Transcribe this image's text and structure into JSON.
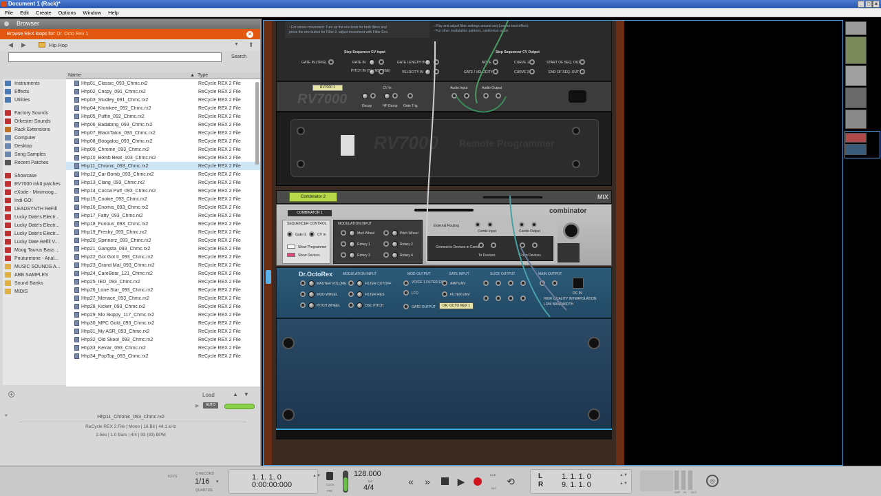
{
  "window": {
    "title": "Document 1 (Rack)*"
  },
  "menu": [
    "File",
    "Edit",
    "Create",
    "Options",
    "Window",
    "Help"
  ],
  "browser": {
    "title": "Browser",
    "banner_prefix": "Browse REX loops for:",
    "banner_target": "Dr. Octo Rex 1",
    "path": "Hip Hop",
    "search_placeholder": "",
    "search_label": "Search",
    "col_name": "Name",
    "col_type": "Type",
    "locations": [
      {
        "label": "Instruments",
        "color": "#4a7ab8"
      },
      {
        "label": "Effects",
        "color": "#4a7ab8"
      },
      {
        "label": "Utilities",
        "color": "#4a7ab8"
      },
      {
        "label": "",
        "color": ""
      },
      {
        "label": "Factory Sounds",
        "color": "#c03030"
      },
      {
        "label": "Orkester Sounds",
        "color": "#c03030"
      },
      {
        "label": "Rack Extensions",
        "color": "#c07020"
      },
      {
        "label": "Computer",
        "color": "#6a88b0"
      },
      {
        "label": "Desktop",
        "color": "#6a88b0"
      },
      {
        "label": "Song Samples",
        "color": "#6a88b0"
      },
      {
        "label": "Recent Patches",
        "color": "#555555"
      },
      {
        "label": "",
        "color": ""
      },
      {
        "label": "Showcase",
        "color": "#c03030"
      },
      {
        "label": "RV7000 mkII patches",
        "color": "#c03030"
      },
      {
        "label": "eXode - Minimoog...",
        "color": "#c03030"
      },
      {
        "label": "Indi-GO!",
        "color": "#c03030"
      },
      {
        "label": "LEADSYNTH ReFill",
        "color": "#c03030"
      },
      {
        "label": "Lucky Date's Electr...",
        "color": "#c03030"
      },
      {
        "label": "Lucky Date's Electr...",
        "color": "#c03030"
      },
      {
        "label": "Lucky Date's Electr...",
        "color": "#c03030"
      },
      {
        "label": "Lucky Date Refill V...",
        "color": "#c03030"
      },
      {
        "label": "Moog Taurus Bass ...",
        "color": "#c03030"
      },
      {
        "label": "Pnuturetone - Anal...",
        "color": "#c03030"
      },
      {
        "label": "MUSIC SOUNDS A...",
        "color": "#e0b040"
      },
      {
        "label": "ABB SAMPLES",
        "color": "#e0b040"
      },
      {
        "label": "Sound Banks",
        "color": "#e0b040"
      },
      {
        "label": "MIDIS",
        "color": "#e0b040"
      }
    ],
    "files": [
      {
        "name": "Hhp01_Classic_093_Chmc.rx2",
        "type": "ReCycle REX 2 File"
      },
      {
        "name": "Hhp02_Crispy_091_Chmc.rx2",
        "type": "ReCycle REX 2 File"
      },
      {
        "name": "Hhp03_Studley_091_Chmc.rx2",
        "type": "ReCycle REX 2 File"
      },
      {
        "name": "Hhp04_Kronikee_092_Chmc.rx2",
        "type": "ReCycle REX 2 File"
      },
      {
        "name": "Hhp05_Puffin_092_Chmc.rx2",
        "type": "ReCycle REX 2 File"
      },
      {
        "name": "Hhp06_Badabing_093_Chmc.rx2",
        "type": "ReCycle REX 2 File"
      },
      {
        "name": "Hhp07_BlackTalon_093_Chmc.rx2",
        "type": "ReCycle REX 2 File"
      },
      {
        "name": "Hhp08_Boogaloo_093_Chmc.rx2",
        "type": "ReCycle REX 2 File"
      },
      {
        "name": "Hhp09_Chrome_093_Chmc.rx2",
        "type": "ReCycle REX 2 File"
      },
      {
        "name": "Hhp10_Bomb Beat_103_Chmc.rx2",
        "type": "ReCycle REX 2 File"
      },
      {
        "name": "Hhp11_Chronic_093_Chmc.rx2",
        "type": "ReCycle REX 2 File"
      },
      {
        "name": "Hhp12_Car Bomb_093_Chmc.rx2",
        "type": "ReCycle REX 2 File"
      },
      {
        "name": "Hhp13_Clang_093_Chmc.rx2",
        "type": "ReCycle REX 2 File"
      },
      {
        "name": "Hhp14_Cocoa Puff_093_Chmc.rx2",
        "type": "ReCycle REX 2 File"
      },
      {
        "name": "Hhp15_Cookie_093_Chmc.rx2",
        "type": "ReCycle REX 2 File"
      },
      {
        "name": "Hhp16_Enomis_093_Chmc.rx2",
        "type": "ReCycle REX 2 File"
      },
      {
        "name": "Hhp17_Fatty_093_Chmc.rx2",
        "type": "ReCycle REX 2 File"
      },
      {
        "name": "Hhp18_Furious_093_Chmc.rx2",
        "type": "ReCycle REX 2 File"
      },
      {
        "name": "Hhp19_Freshy_093_Chmc.rx2",
        "type": "ReCycle REX 2 File"
      },
      {
        "name": "Hhp20_Spinnerz_093_Chmc.rx2",
        "type": "ReCycle REX 2 File"
      },
      {
        "name": "Hhp21_Gangsta_093_Chmc.rx2",
        "type": "ReCycle REX 2 File"
      },
      {
        "name": "Hhp22_Got Got It_093_Chmc.rx2",
        "type": "ReCycle REX 2 File"
      },
      {
        "name": "Hhp23_Grand Mal_093_Chmc.rx2",
        "type": "ReCycle REX 2 File"
      },
      {
        "name": "Hhp24_CareBear_121_Chmc.rx2",
        "type": "ReCycle REX 2 File"
      },
      {
        "name": "Hhp25_IED_093_Chmc.rx2",
        "type": "ReCycle REX 2 File"
      },
      {
        "name": "Hhp26_Lone Star_093_Chmc.rx2",
        "type": "ReCycle REX 2 File"
      },
      {
        "name": "Hhp27_Menace_093_Chmc.rx2",
        "type": "ReCycle REX 2 File"
      },
      {
        "name": "Hhp28_Kicker_093_Chmc.rx2",
        "type": "ReCycle REX 2 File"
      },
      {
        "name": "Hhp29_Mo Skippy_117_Chmc.rx2",
        "type": "ReCycle REX 2 File"
      },
      {
        "name": "Hhp30_MPC Gold_093_Chmc.rx2",
        "type": "ReCycle REX 2 File"
      },
      {
        "name": "Hhp31_My ASR_093_Chmc.rx2",
        "type": "ReCycle REX 2 File"
      },
      {
        "name": "Hhp32_Old Skool_093_Chmc.rx2",
        "type": "ReCycle REX 2 File"
      },
      {
        "name": "Hhp33_Kevlar_093_Chmc.rx2",
        "type": "ReCycle REX 2 File"
      },
      {
        "name": "Hhp34_PopTop_093_Chmc.rx2",
        "type": "ReCycle REX 2 File"
      }
    ],
    "selected_index": 10,
    "load_label": "Load",
    "auto_label": "AUTO",
    "preview": {
      "filename": "Hhp11_Chronic_093_Chmc.rx2",
      "info": "ReCycle REX 2 File | Mono | 16 Bit | 44.1 kHz",
      "stats": "2.58s | 1.0 Bars | 4/4 | 93 (93) BPM"
    }
  },
  "rack": {
    "rv7000": {
      "notes": [
        "- For stereo movement: Turn up the env knob for both filters and",
        "press the env button for Filter 2. adjust movement with Filter Env.",
        "- Play and adjust filter settings around seq (use for best effect)",
        "- For other modulation patterns, randomize again"
      ],
      "seq_in_title": "Step Sequencer CV Input",
      "seq_out_title": "Step Sequencer CV Output",
      "gate_in": "GATE IN (TRIG)",
      "rate_in": "RATE IN",
      "pitch_in": "PITCH IN (TRANSPOSE)",
      "gate_length_in": "GATE LENGTH IN",
      "velocity_in": "VELOCITY IN",
      "note": "NOTE",
      "gate_velocity": "GATE / VELOCITY",
      "curve1": "CURVE 1",
      "curve2": "CURVE 2",
      "start_seq_out": "START OF SEQ. OUT",
      "end_seq_out": "END OF SEQ. OUT",
      "name_tag": "RV7000 1",
      "cv_in": "CV In",
      "decay": "Decay",
      "hf_damp": "HF Damp",
      "gate_trig": "Gate Trig",
      "audio_input": "Audio Input",
      "audio_output": "Audio Output",
      "logo": "RV7000",
      "remote_title": "RV7000",
      "remote_sub": "Remote Programmer"
    },
    "combinator": {
      "tab": "Combinator 2",
      "mix": "MIX",
      "name_tag": "COMBINATOR 1",
      "brand": "combinator",
      "seq_control": "SEQUENCER CONTROL",
      "mod_input": "MODULATION INPUT",
      "gate_in": "Gate In",
      "cv_in": "CV In",
      "mod_wheel": "Mod Wheel",
      "pitch_wheel": "Pitch Wheel",
      "rotary1": "Rotary 1",
      "rotary2": "Rotary 2",
      "rotary3": "Rotary 3",
      "rotary4": "Rotary 4",
      "show_programmer": "Show Programmer",
      "show_devices": "Show Devices",
      "external_routing": "External Routing",
      "combi_input": "Combi Input",
      "combi_output": "Combi Output",
      "connect_label": "Connect to Devices in Combi",
      "to_devices": "To Devices",
      "from_devices": "From Devices"
    },
    "drocto": {
      "brand": "Dr.OctoRex",
      "mod_input": "MODULATION INPUT",
      "master_volume": "MASTER VOLUME",
      "filter_cutoff": "FILTER CUTOFF",
      "mod_wheel": "MOD WHEEL",
      "filter_res": "FILTER RES",
      "pitch_wheel": "PITCH WHEEL",
      "osc_pitch": "OSC PITCH",
      "mod_output": "MOD OUTPUT",
      "voice1_filter_env": "VOICE 1 FILTER ENV",
      "lfo": "LFO",
      "gate_output": "GATE OUTPUT",
      "gate_input": "GATE INPUT",
      "amp_env": "AMP ENV",
      "filter_env": "FILTER ENV",
      "slice_output": "SLICE OUTPUT",
      "main_output": "MAIN OUTPUT",
      "name_tag": "DR. OCTO REX 1",
      "hq_interp": "HIGH QUALITY INTERPOLATION",
      "low_bandwidth": "LOW BANDWIDTH",
      "dc_in": "DC IN"
    }
  },
  "transport": {
    "keys_label": "KEYS",
    "q_record_label": "Q RECORD",
    "quantize_value": "1/16",
    "quantize_label": "QUANTIZE",
    "position_bars": "1.  1.  1.    0",
    "position_time": "0:00:00:000",
    "click_label": "CLICK",
    "pre_label": "PRE",
    "tempo": "128.000",
    "tap_label": "TAP",
    "signature": "4/4",
    "dub_label": "DUB",
    "alt_label": "ALT",
    "loop_left_label": "L",
    "loop_right_label": "R",
    "loop_left": "1.  1.  1.    0",
    "loop_right": "9.  1.  1.    0",
    "dsp_label": "DSP",
    "in_label": "IN",
    "out_label": "OUT",
    "record_color": "#d2141e"
  }
}
